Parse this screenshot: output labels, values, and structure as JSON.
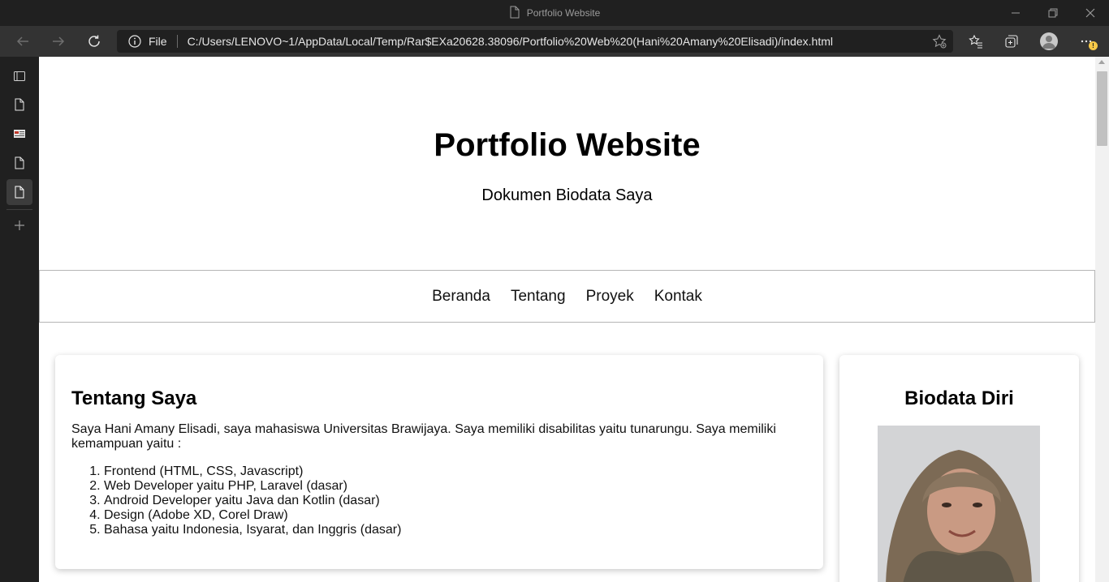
{
  "window": {
    "title": "Portfolio Website"
  },
  "toolbar": {
    "file_label": "File",
    "url": "C:/Users/LENOVO~1/AppData/Local/Temp/Rar$EXa20628.38096/Portfolio%20Web%20(Hani%20Amany%20Elisadi)/index.html",
    "notification_count": "!"
  },
  "page": {
    "header": {
      "title": "Portfolio Website",
      "subtitle": "Dokumen Biodata Saya"
    },
    "nav": [
      "Beranda",
      "Tentang",
      "Proyek",
      "Kontak"
    ],
    "about": {
      "heading": "Tentang Saya",
      "intro": "Saya Hani Amany Elisadi, saya mahasiswa Universitas Brawijaya. Saya memiliki disabilitas yaitu tunarungu. Saya memiliki kemampuan yaitu :",
      "skills": [
        "Frontend (HTML, CSS, Javascript)",
        "Web Developer yaitu PHP, Laravel (dasar)",
        "Android Developer yaitu Java dan Kotlin (dasar)",
        "Design (Adobe XD, Corel Draw)",
        "Bahasa yaitu Indonesia, Isyarat, dan Inggris (dasar)"
      ]
    },
    "bio": {
      "heading": "Biodata Diri"
    }
  },
  "colors": {
    "browser_frame": "#202020",
    "toolbar": "#333333",
    "page_bg": "#ffffff",
    "badge": "#f7c948"
  }
}
